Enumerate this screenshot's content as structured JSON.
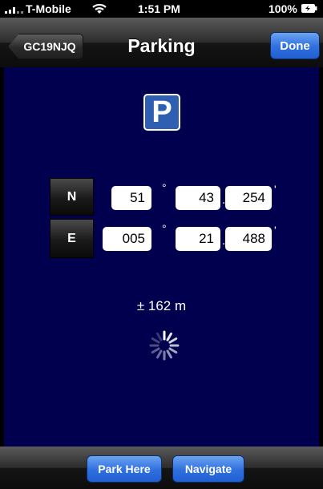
{
  "status_bar": {
    "carrier": "T-Mobile",
    "time": "1:51 PM",
    "battery": "100%",
    "icons": [
      "signal-icon",
      "wifi-icon",
      "battery-icon"
    ]
  },
  "nav": {
    "back_label": "GC19NJQ",
    "title": "Parking",
    "done_label": "Done"
  },
  "parking_sign": {
    "letter": "P",
    "icon": "parking-icon",
    "color": "#2f5fb0"
  },
  "coords": {
    "lat": {
      "hemisphere": "N",
      "deg": "51",
      "deg_symbol": "°",
      "min": "43",
      "sep": ".",
      "dec": "254",
      "min_symbol": "'"
    },
    "lon": {
      "hemisphere": "E",
      "deg": "005",
      "deg_symbol": "°",
      "min": "21",
      "sep": ".",
      "dec": "488",
      "min_symbol": "'"
    }
  },
  "accuracy": "± 162 m",
  "toolbar": {
    "park_label": "Park Here",
    "navigate_label": "Navigate"
  },
  "colors": {
    "background": "#00004e",
    "accent": "#2f6fde"
  }
}
